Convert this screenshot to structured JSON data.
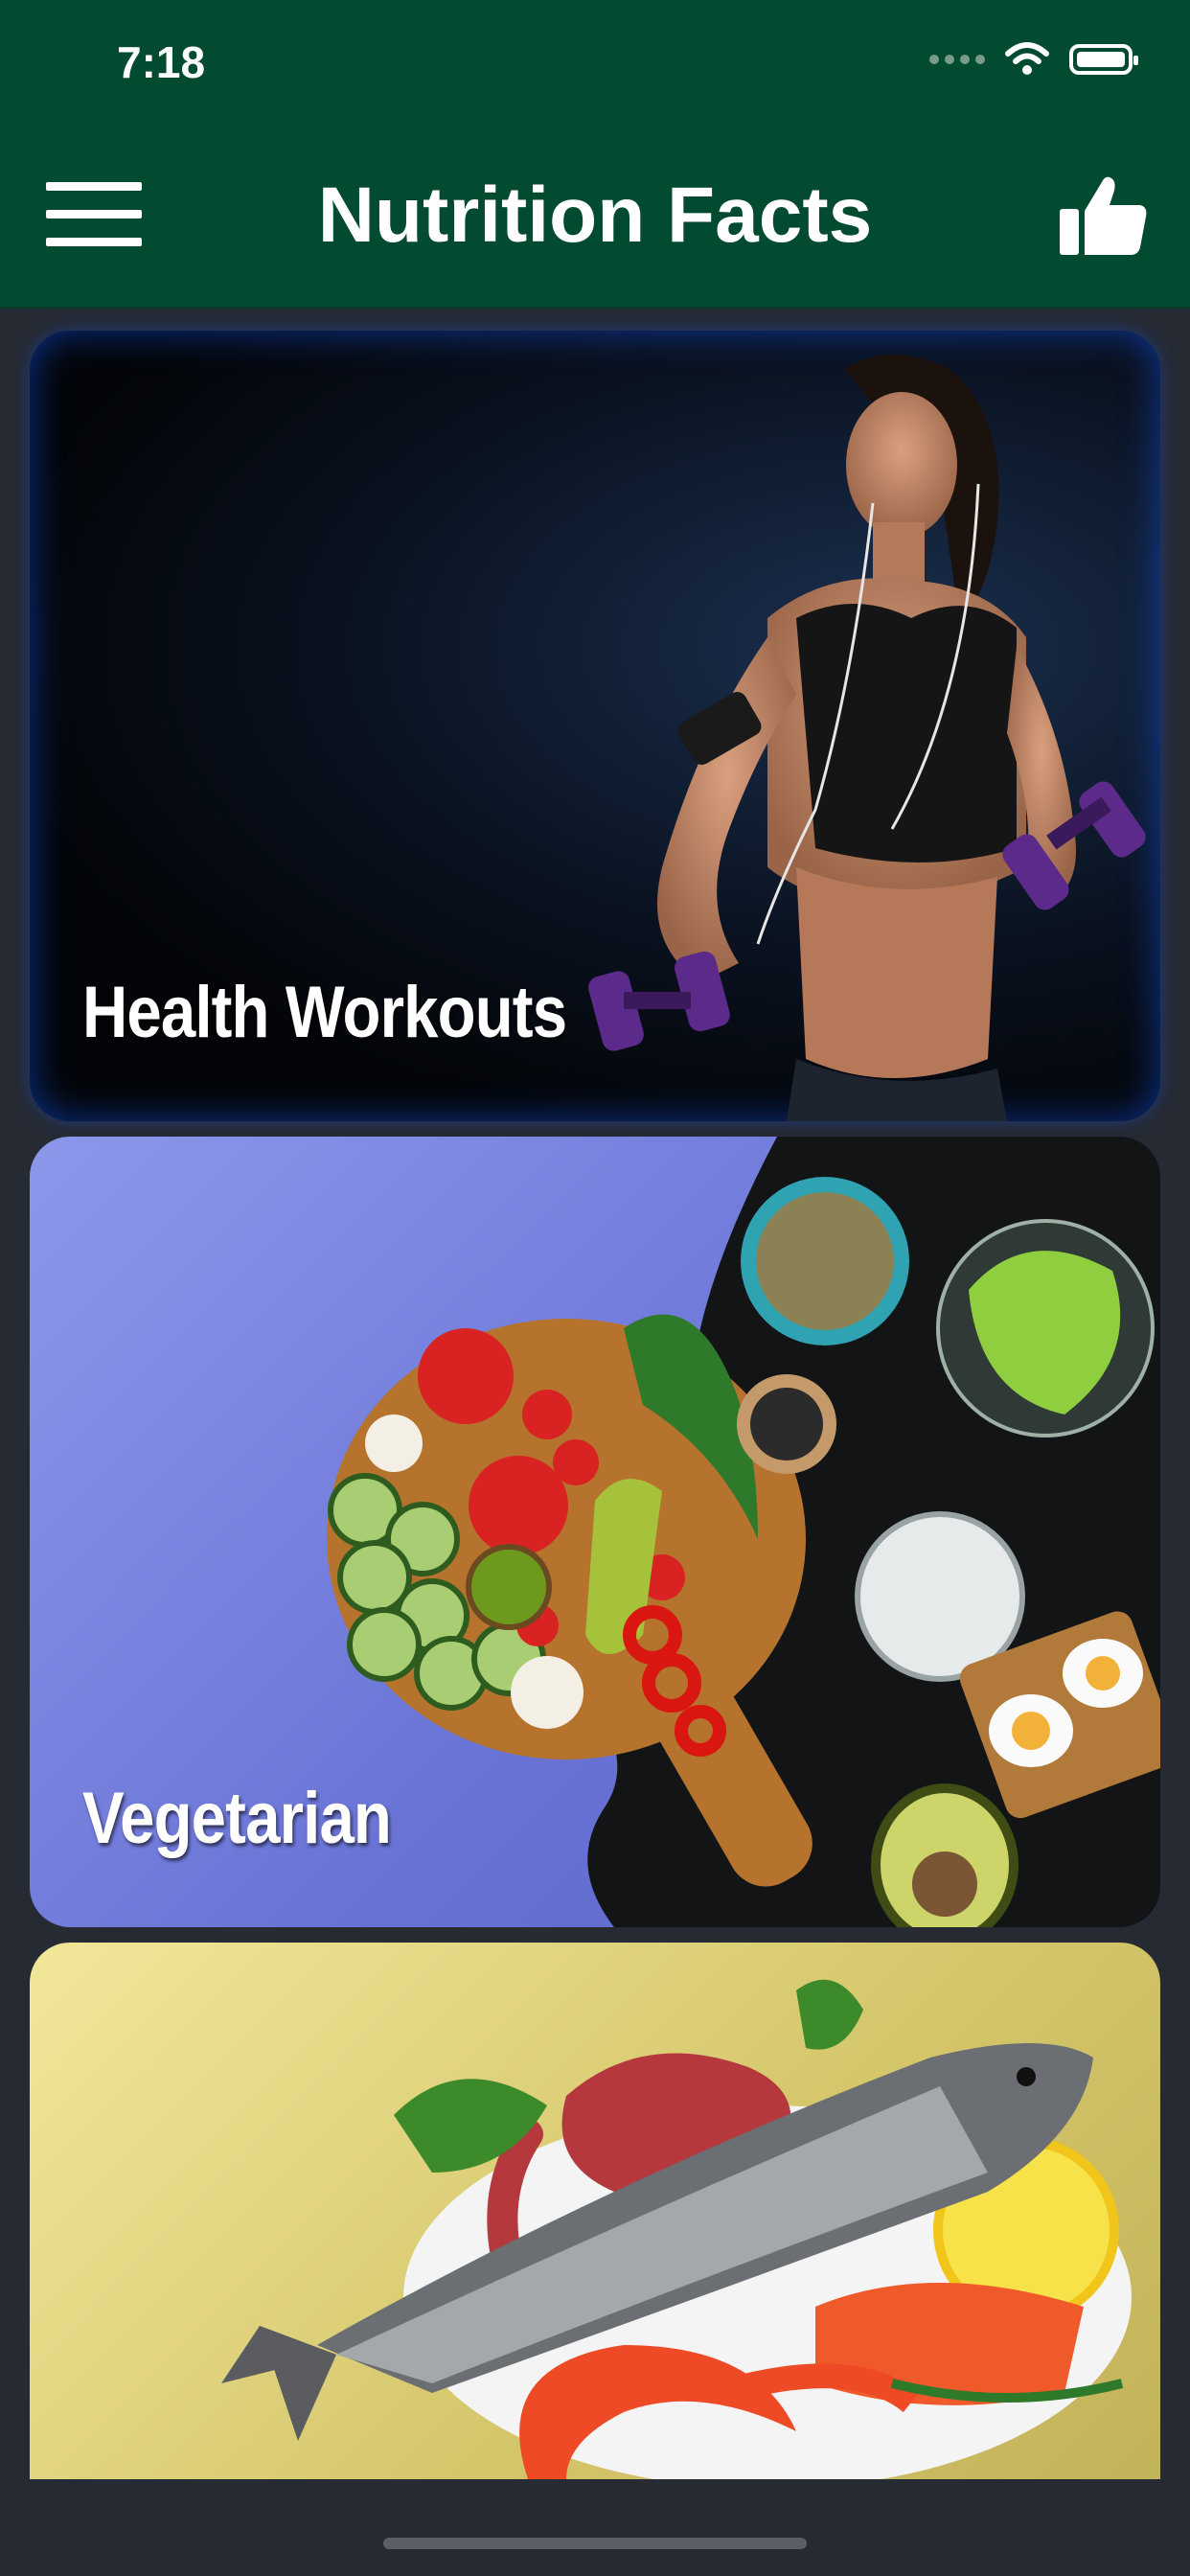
{
  "status_bar": {
    "time": "7:18"
  },
  "header": {
    "title": "Nutrition Facts"
  },
  "cards": [
    {
      "label": "Health Workouts"
    },
    {
      "label": "Vegetarian"
    },
    {
      "label": ""
    }
  ],
  "colors": {
    "header_bg": "#024a30",
    "page_bg": "#262a33",
    "vegetarian_bg": "#7a84e0",
    "seafood_bg": "#e4d57f"
  },
  "icons": {
    "menu": "hamburger-icon",
    "like": "thumbs-up-icon",
    "wifi": "wifi-icon",
    "battery": "battery-icon"
  }
}
